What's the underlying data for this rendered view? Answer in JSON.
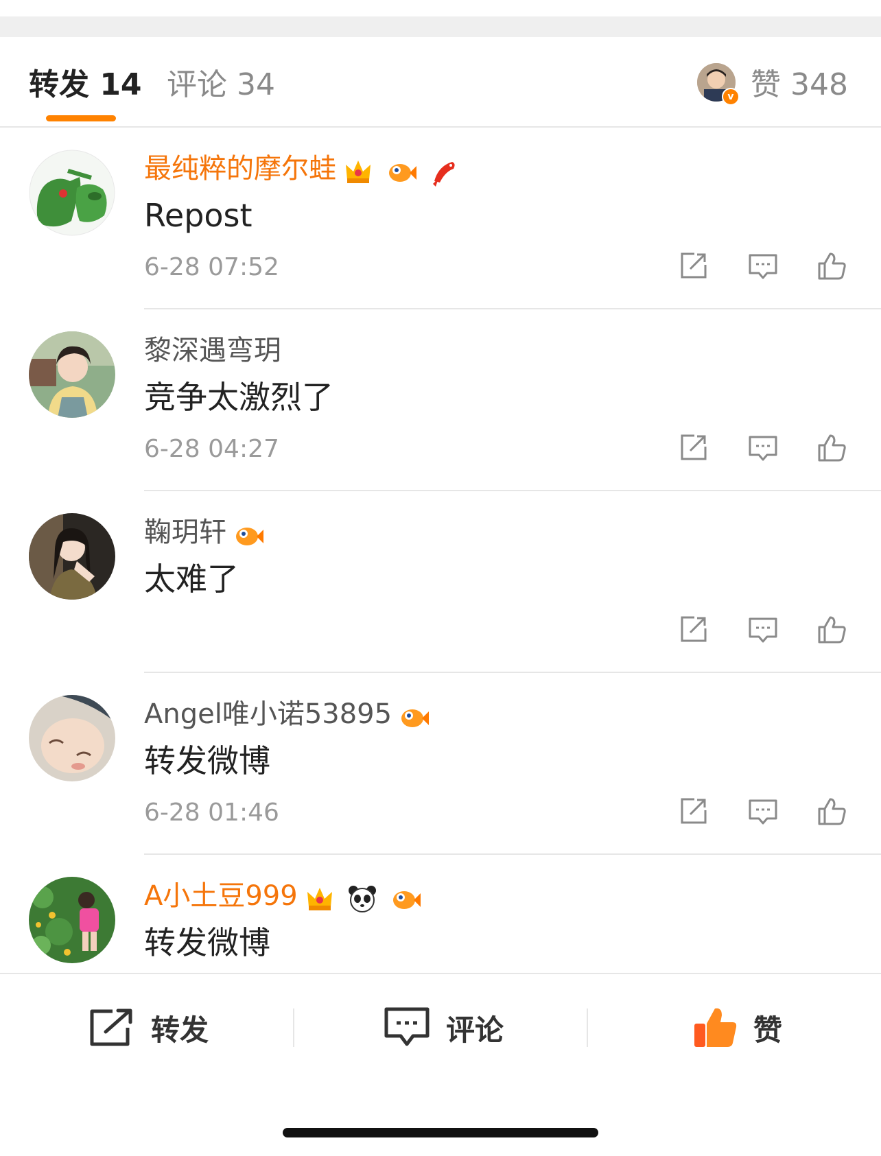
{
  "header": {
    "repost_tab": "转发 14",
    "comment_tab": "评论 34",
    "like_tab": "赞 348"
  },
  "colors": {
    "accent": "#ff8200",
    "vip_name": "#f5750a",
    "muted": "#9a9a9a"
  },
  "reposts": [
    {
      "name": "最纯粹的摩尔蛙",
      "vip": true,
      "badges": [
        "crown-icon",
        "fish-icon",
        "koi-icon"
      ],
      "text": "Repost",
      "time": "6-28 07:52"
    },
    {
      "name": "黎深遇弯玥",
      "vip": false,
      "badges": [],
      "text": "竞争太激烈了",
      "time": "6-28 04:27"
    },
    {
      "name": "鞠玥轩",
      "vip": false,
      "badges": [
        "fish-icon"
      ],
      "text": "太难了",
      "time": ""
    },
    {
      "name": "Angel唯小诺53895",
      "vip": false,
      "badges": [
        "fish-icon"
      ],
      "text": "转发微博",
      "time": "6-28 01:46"
    },
    {
      "name": "A小土豆999",
      "vip": true,
      "badges": [
        "crown-icon",
        "panda-icon",
        "fish-icon"
      ],
      "text": "转发微博",
      "time": ""
    }
  ],
  "bottom_bar": {
    "repost_label": "转发",
    "comment_label": "评论",
    "like_label": "赞"
  }
}
